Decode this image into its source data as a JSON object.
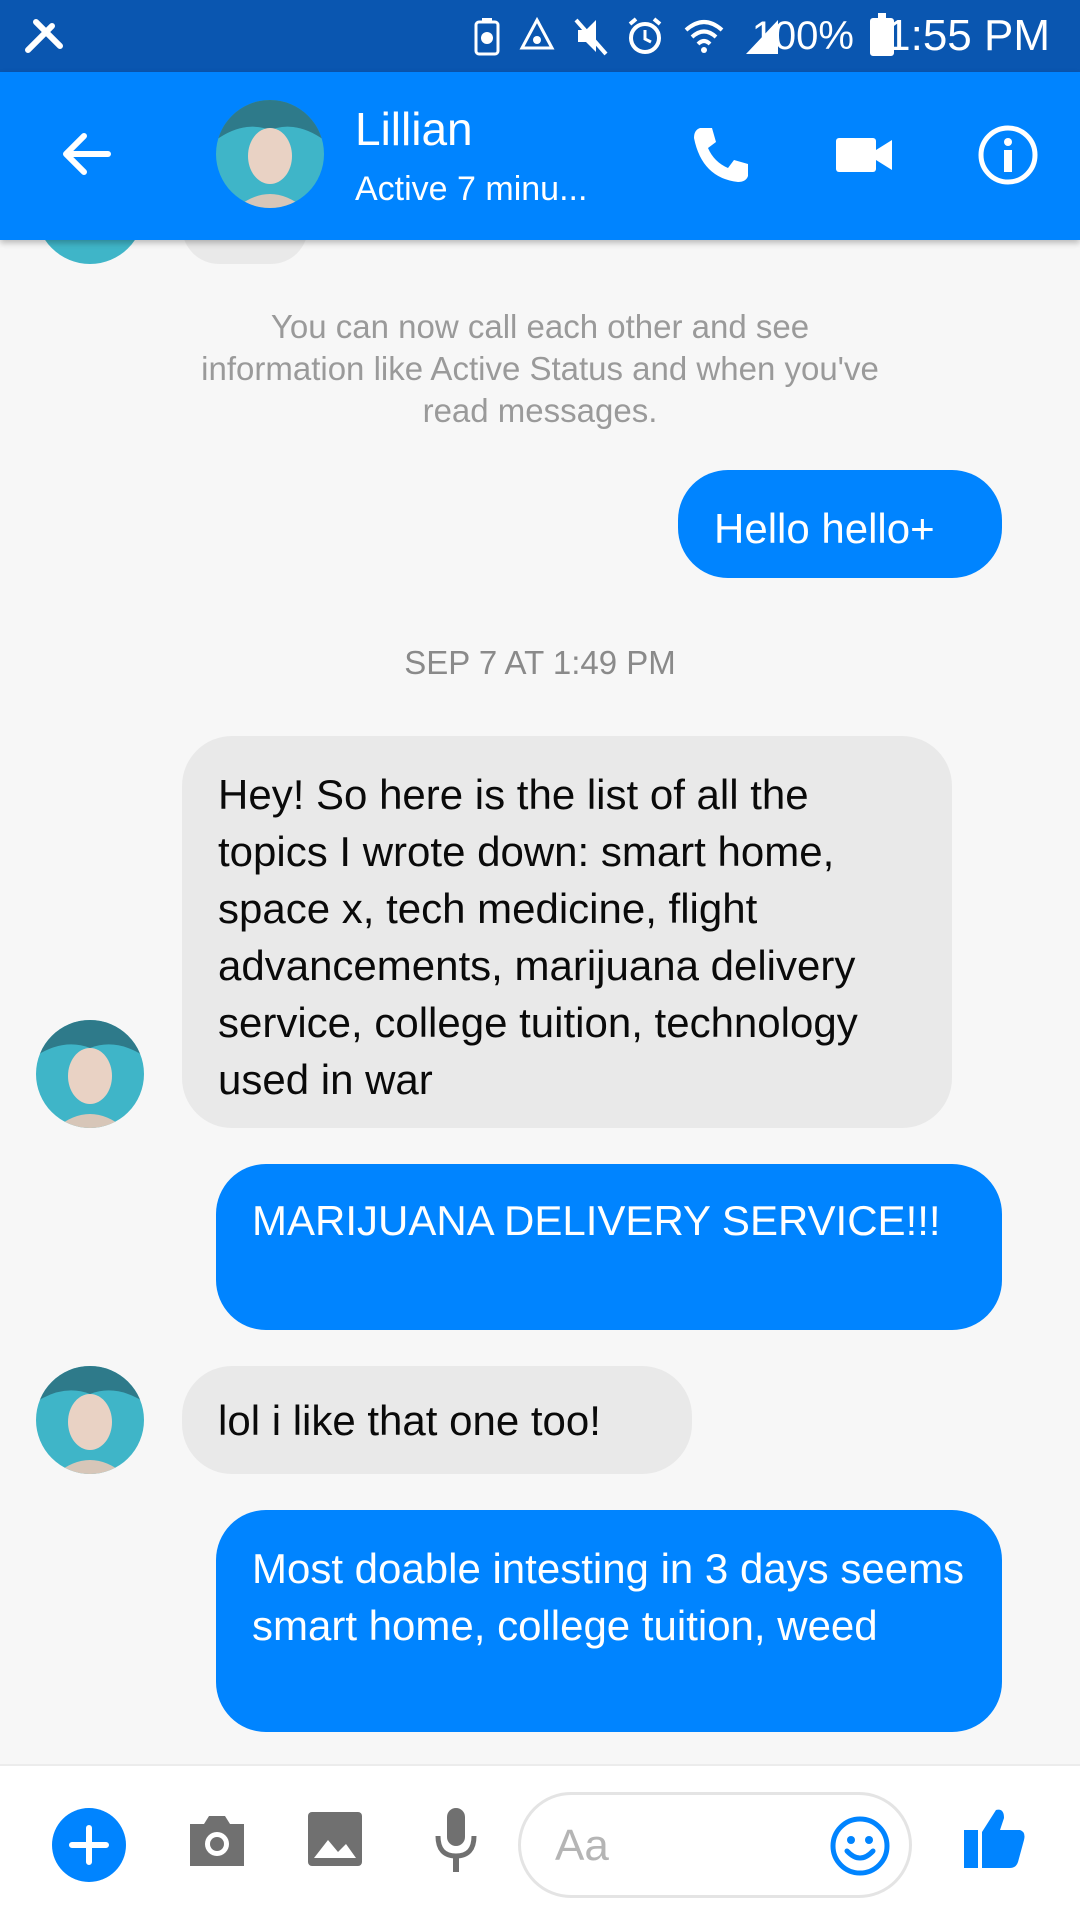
{
  "status_bar": {
    "battery": "100%",
    "time": "1:55 PM"
  },
  "header": {
    "name": "Lillian",
    "status": "Active 7 minu..."
  },
  "messages": {
    "system_notice": "You can now call each other and see information like Active Status and when you've read messages.",
    "timestamp": "SEP 7 AT 1:49 PM",
    "m1": "Hello hello+",
    "m2": "Hey! So here is the list of all the topics I wrote down: smart home, space x, tech medicine, flight advancements, marijuana delivery service, college tuition, technology used in war",
    "m3": "MARIJUANA DELIVERY SERVICE!!!",
    "m4": "lol i like that one too!",
    "m5": "Most doable intesting in 3 days seems smart home, college tuition, weed"
  },
  "composer": {
    "placeholder": "Aa"
  },
  "colors": {
    "accent": "#0084ff",
    "status_bar": "#0a56b0"
  }
}
